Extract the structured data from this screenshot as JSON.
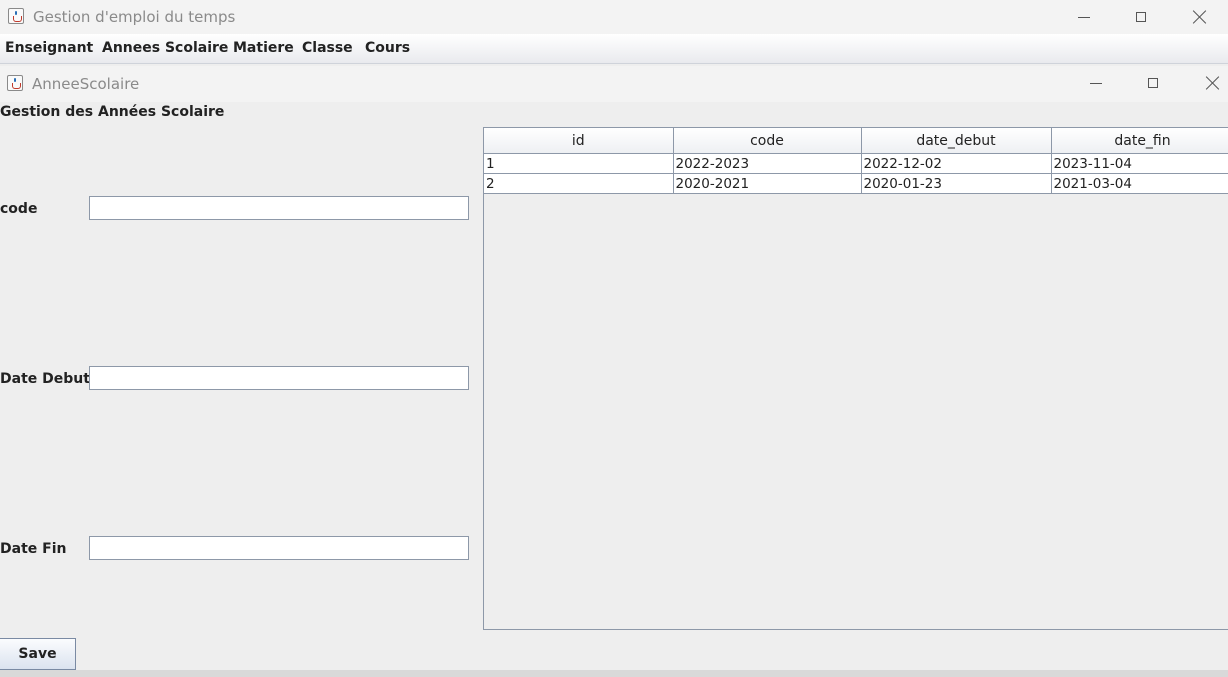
{
  "app": {
    "title": "Gestion d'emploi du temps"
  },
  "menu": {
    "items": [
      "Enseignant",
      "Annees Scolaire",
      "Matiere",
      "Classe",
      "Cours"
    ]
  },
  "internal_frame": {
    "title": "AnneeScolaire"
  },
  "form": {
    "section_title": "Gestion des Années Scolaire",
    "code_label": "code",
    "code_value": "",
    "date_debut_label": "Date Debut",
    "date_debut_value": "",
    "date_fin_label": "Date Fin",
    "date_fin_value": "",
    "save_label": "Save"
  },
  "table": {
    "columns": [
      "id",
      "code",
      "date_debut",
      "date_fin"
    ],
    "rows": [
      [
        "1",
        "2022-2023",
        "2022-12-02",
        "2023-11-04"
      ],
      [
        "2",
        "2020-2021",
        "2020-01-23",
        "2021-03-04"
      ]
    ]
  }
}
